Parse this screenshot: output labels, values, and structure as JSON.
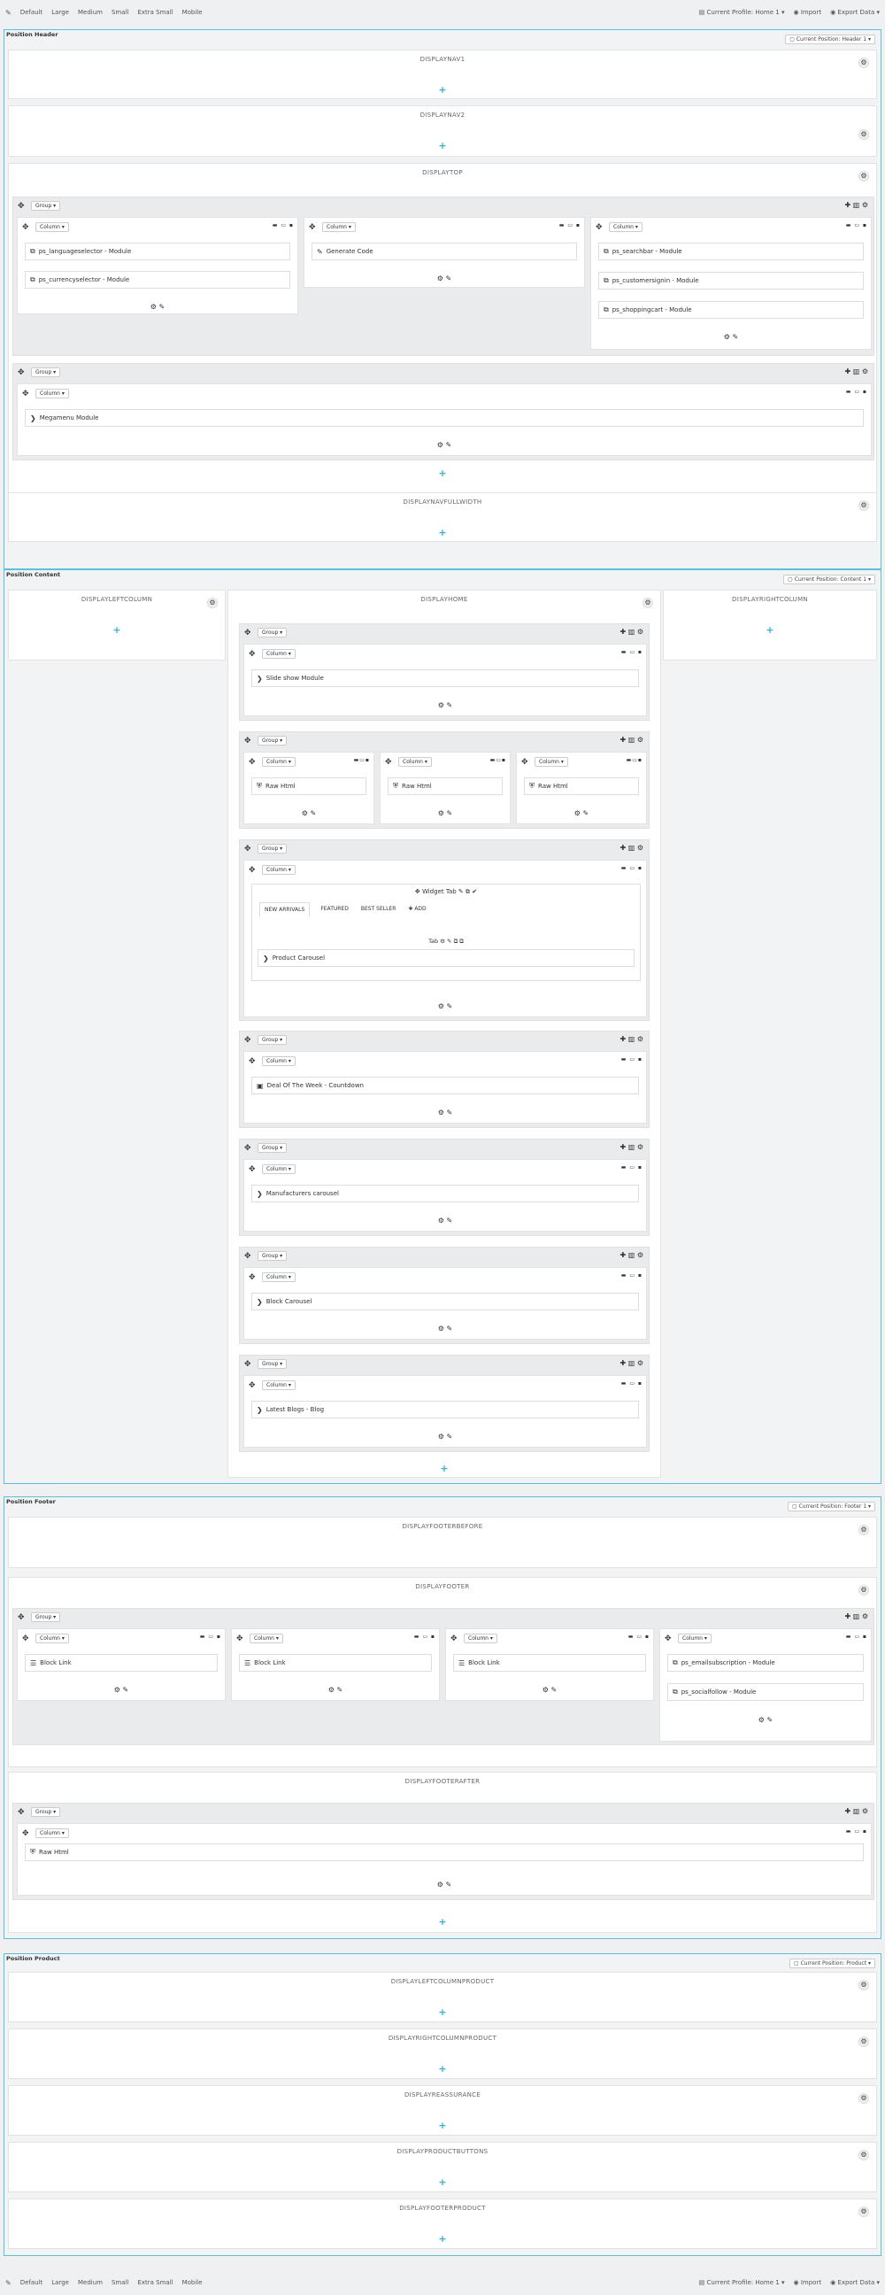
{
  "toolbar": {
    "toggle_icon": "pencil-icon",
    "devices": [
      "Default",
      "Large",
      "Medium",
      "Small",
      "Extra Small",
      "Mobile"
    ],
    "profile_label": "Current Profile: Home 1 ▾",
    "import_label": "Import",
    "export_label": "Export Data ▾"
  },
  "header": {
    "title": "Position Header",
    "profile": "Current Position: Header 1 ▾",
    "hooks": [
      "DISPLAYNAV1",
      "DISPLAYNAV2",
      "DISPLAYTOP",
      "DISPLAYNAVFULLWIDTH"
    ]
  },
  "content": {
    "title": "Position Content",
    "profile": "Current Position: Content 1 ▾",
    "hooks": [
      "DISPLAYLEFTCOLUMN",
      "DISPLAYHOME",
      "DISPLAYRIGHTCOLUMN"
    ]
  },
  "footer": {
    "title": "Position Footer",
    "profile": "Current Position: Footer 1 ▾",
    "hooks": [
      "DISPLAYFOOTERBEFORE",
      "DISPLAYFOOTER",
      "DISPLAYFOOTERAFTER"
    ]
  },
  "product": {
    "title": "Position Product",
    "profile": "Current Position: Product ▾",
    "hooks": [
      "DISPLAYLEFTCOLUMNPRODUCT",
      "DISPLAYRIGHTCOLUMNPRODUCT",
      "DISPLAYREASSURANCE",
      "DISPLAYPRODUCTBUTTONS",
      "DISPLAYFOOTERPRODUCT"
    ]
  },
  "ui": {
    "group_label": "Group ▾",
    "column_label": "Column ▾",
    "add_symbol": "+",
    "gear_symbol": "⚙"
  },
  "modules": {
    "top_col1": [
      "ps_languageselector - Module",
      "ps_currencyselector - Module"
    ],
    "top_col2": [
      "Generate Code"
    ],
    "top_col3": [
      "ps_searchbar - Module",
      "ps_customersignin - Module",
      "ps_shoppingcart - Module"
    ],
    "megamenu": "Megamenu Module",
    "slideshow": "Slide show Module",
    "raw_html": "Raw Html",
    "widget_tab_label": "Widget Tab",
    "tabs": [
      "NEW ARRIVALS",
      "FEATURED",
      "BEST SELLER"
    ],
    "tab_add": "ADD",
    "tab_label": "Tab",
    "product_carousel": "Product Carousel",
    "deal_of_week": "Deal Of The Week - Countdown",
    "manufacturers": "Manufacturers carousel",
    "block_carousel": "Block Carousel",
    "latest_blogs": "Latest Blogs - Blog",
    "block_link": "Block Link",
    "email_subscription": "ps_emailsubscription - Module",
    "social_follow": "ps_socialfollow - Module"
  }
}
